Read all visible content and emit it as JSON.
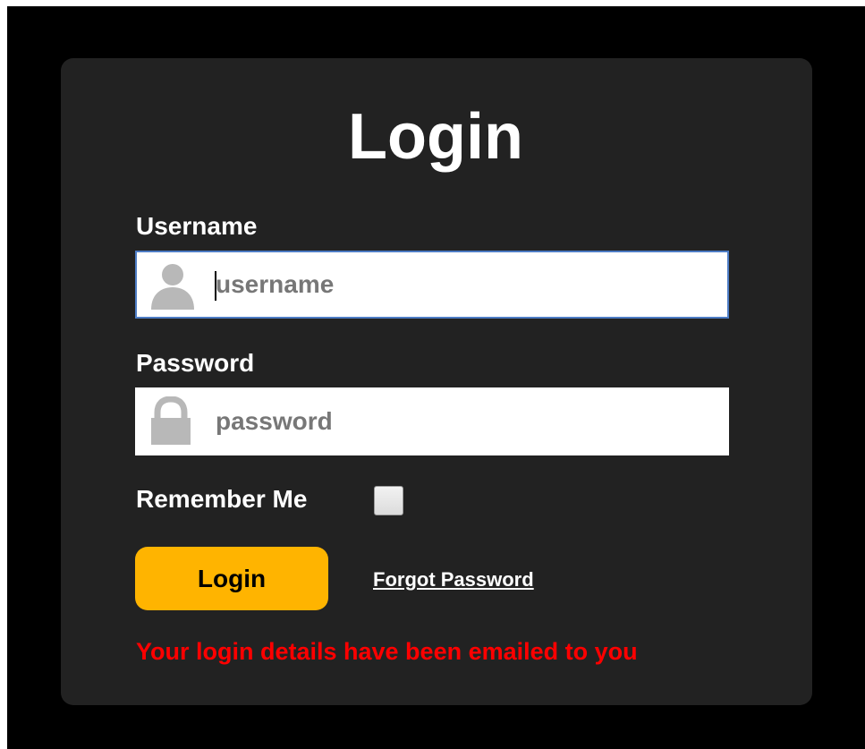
{
  "login_form": {
    "title": "Login",
    "username": {
      "label": "Username",
      "placeholder": "username",
      "value": "",
      "icon": "user-icon"
    },
    "password": {
      "label": "Password",
      "placeholder": "password",
      "value": "",
      "icon": "lock-icon"
    },
    "remember_me": {
      "label": "Remember Me",
      "checked": false
    },
    "submit_label": "Login",
    "forgot_password_label": "Forgot Password",
    "status_message": "Your login details have been emailed to you"
  },
  "colors": {
    "backdrop": "#000000",
    "card": "#222222",
    "accent_button": "#ffb400",
    "focus_border": "#4d7cc4",
    "error_text": "#ff0000"
  }
}
